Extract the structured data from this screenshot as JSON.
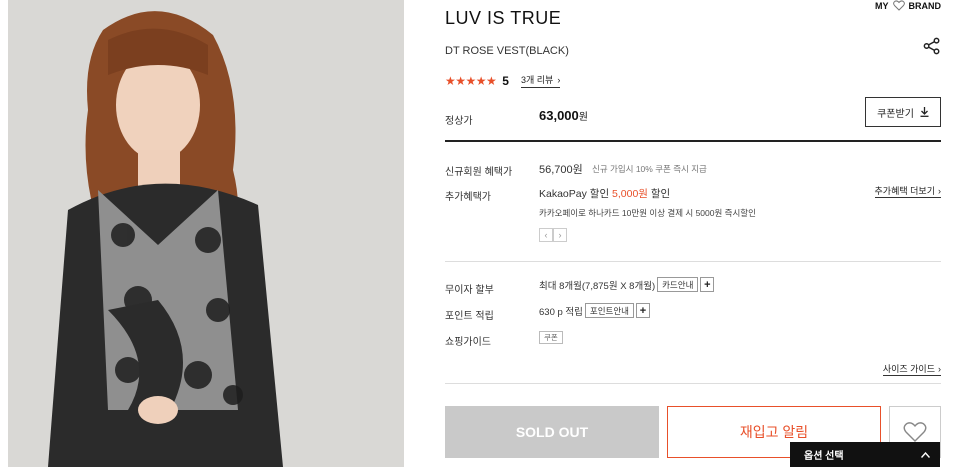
{
  "header": {
    "brand": "LUV IS TRUE",
    "my_prefix": "MY",
    "my_suffix": "BRAND"
  },
  "product": {
    "name": "DT ROSE VEST(BLACK)",
    "stars": "★★★★★",
    "score": "5",
    "review_link": "3개 리뷰"
  },
  "price": {
    "label": "정상가",
    "amount": "63,000",
    "unit": "원",
    "coupon_button": "쿠폰받기"
  },
  "benefits": {
    "new_member_label": "신규회원 혜택가",
    "new_member_price": "56,700원",
    "new_member_note": "신규 가입시 10% 쿠폰 즉시 지급",
    "extra_label": "추가혜택가",
    "kakao_prefix": "KakaoPay 할인 ",
    "kakao_amount": "5,000원",
    "kakao_suffix": " 할인",
    "kakao_desc": "카카오페이로 하나카드 10만원 이상 결제 시 5000원 즉시할인",
    "more_link": "추가혜택 더보기",
    "pager_prev": "‹",
    "pager_next": "›"
  },
  "installment": {
    "label": "무이자 할부",
    "text": "최대 8개월(7,875원 X 8개월)",
    "card_button": "카드안내"
  },
  "points": {
    "label": "포인트 적립",
    "text": "630 p 적립",
    "button": "포인트안내"
  },
  "shopping": {
    "label": "쇼핑가이드",
    "tag": "쿠폰",
    "size_guide": "사이즈 가이드"
  },
  "actions": {
    "soldout": "SOLD OUT",
    "restock": "재입고 알림",
    "option_select": "옵션 선택"
  },
  "icons": {
    "download": "download-icon",
    "heart": "heart-icon",
    "share": "share-icon"
  },
  "colors": {
    "accent": "#e8502a",
    "soldout": "#c9c9c9",
    "option_bar": "#111111"
  }
}
